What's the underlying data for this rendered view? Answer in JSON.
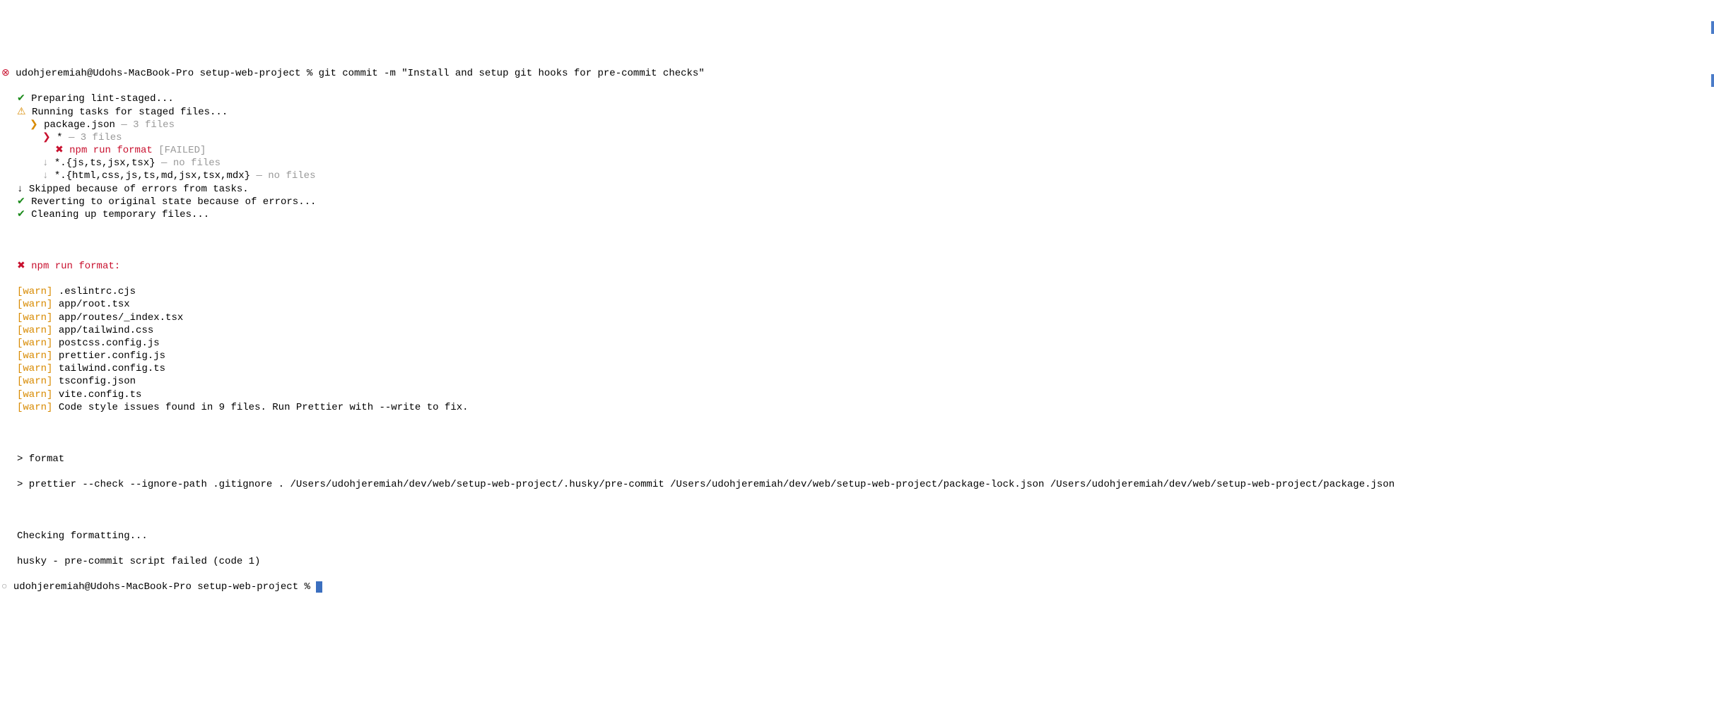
{
  "prompt1": {
    "icon": "⊗",
    "user": "udohjeremiah@Udohs-MacBook-Pro",
    "dir": "setup-web-project",
    "sep": "%",
    "cmd": "git commit -m \"Install and setup git hooks for pre-commit checks\""
  },
  "steps": [
    {
      "icon": "✔",
      "iconColor": "green",
      "text": "Preparing lint-staged...",
      "indent": 1
    },
    {
      "icon": "⚠",
      "iconColor": "orange",
      "text": "Running tasks for staged files...",
      "indent": 1
    },
    {
      "icon": "❯",
      "iconColor": "orange",
      "text": "package.json",
      "suffix": " — 3 files",
      "suffixColor": "gray",
      "indent": 2
    },
    {
      "icon": "❯",
      "iconColor": "red",
      "text": "*",
      "suffix": " — 3 files",
      "suffixColor": "gray",
      "indent": 3,
      "textColor": "black"
    },
    {
      "icon": "✖",
      "iconColor": "red",
      "text": "npm run format",
      "textColor": "red",
      "suffix": " [FAILED]",
      "suffixColor": "gray",
      "indent": 4
    },
    {
      "icon": "↓",
      "iconColor": "gray",
      "text": "*.{js,ts,jsx,tsx}",
      "suffix": " — no files",
      "suffixColor": "gray",
      "indent": 3
    },
    {
      "icon": "↓",
      "iconColor": "gray",
      "text": "*.{html,css,js,ts,md,jsx,tsx,mdx}",
      "suffix": " — no files",
      "suffixColor": "gray",
      "indent": 3
    },
    {
      "icon": "↓",
      "iconColor": "black",
      "text": "Skipped because of errors from tasks.",
      "indent": 1
    },
    {
      "icon": "✔",
      "iconColor": "green",
      "text": "Reverting to original state because of errors...",
      "indent": 1
    },
    {
      "icon": "✔",
      "iconColor": "green",
      "text": "Cleaning up temporary files...",
      "indent": 1
    }
  ],
  "failHeader": {
    "icon": "✖",
    "text": "npm run format:"
  },
  "warns": [
    ".eslintrc.cjs",
    "app/root.tsx",
    "app/routes/_index.tsx",
    "app/tailwind.css",
    "postcss.config.js",
    "prettier.config.js",
    "tailwind.config.ts",
    "tsconfig.json",
    "vite.config.ts",
    "Code style issues found in 9 files. Run Prettier with --write to fix."
  ],
  "warnLabel": "[warn]",
  "formatBlock": {
    "l1": "> format",
    "l2": "> prettier --check --ignore-path .gitignore . /Users/udohjeremiah/dev/web/setup-web-project/.husky/pre-commit /Users/udohjeremiah/dev/web/setup-web-project/package-lock.json /Users/udohjeremiah/dev/web/setup-web-project/package.json"
  },
  "checking": "Checking formatting...",
  "husky": "husky - pre-commit script failed (code 1)",
  "prompt2": {
    "icon": "○",
    "user": "udohjeremiah@Udohs-MacBook-Pro",
    "dir": "setup-web-project",
    "sep": "%"
  }
}
